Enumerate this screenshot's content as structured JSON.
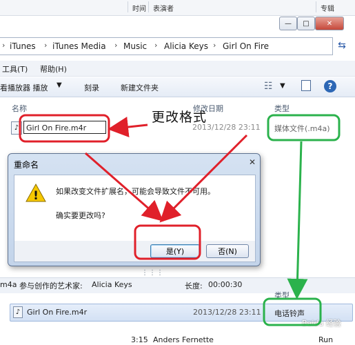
{
  "back_list": {
    "col_time": "时间",
    "col_performer": "表演者",
    "col_album": "专辑"
  },
  "window_controls": {
    "minimize": "—",
    "maximize": "□",
    "close": "✕"
  },
  "breadcrumb": [
    "iTunes",
    "iTunes Media",
    "Music",
    "Alicia Keys",
    "Girl On Fire"
  ],
  "menu": {
    "tools": "工具(T)",
    "help": "帮助(H)"
  },
  "toolbar": {
    "play_with": "看播放器 播放",
    "burn": "刻录",
    "new_folder": "新建文件夹"
  },
  "columns": {
    "name": "名称",
    "date_modified": "修改日期",
    "type": "类型"
  },
  "file_row": {
    "name_edit_value": "Girl On Fire.m4r",
    "date": "2013/12/28 23:11",
    "type": "媒体文件(.m4a)"
  },
  "annotation": {
    "label": "更改格式"
  },
  "dialog": {
    "title": "重命名",
    "message": "如果改变文件扩展名，可能会导致文件不可用。",
    "question": "确实要更改吗?",
    "yes": "是(Y)",
    "no": "否(N)"
  },
  "details_pane": {
    "format": "m4a",
    "artist_label": "参与创作的艺术家:",
    "artist": "Alicia Keys",
    "length_label": "长度:",
    "length": "00:00:30"
  },
  "lower_list": {
    "type_header": "类型",
    "file_name": "Girl On Fire.m4r",
    "date": "2013/12/28 23:11",
    "type": "电话铃声"
  },
  "bottom_row": {
    "time": "3:15",
    "artist": "Anders Fernette",
    "album": "Run"
  },
  "watermark": "Baidu 经验",
  "colors": {
    "annotation_red": "#e0202a",
    "annotation_green": "#2bb24c"
  }
}
